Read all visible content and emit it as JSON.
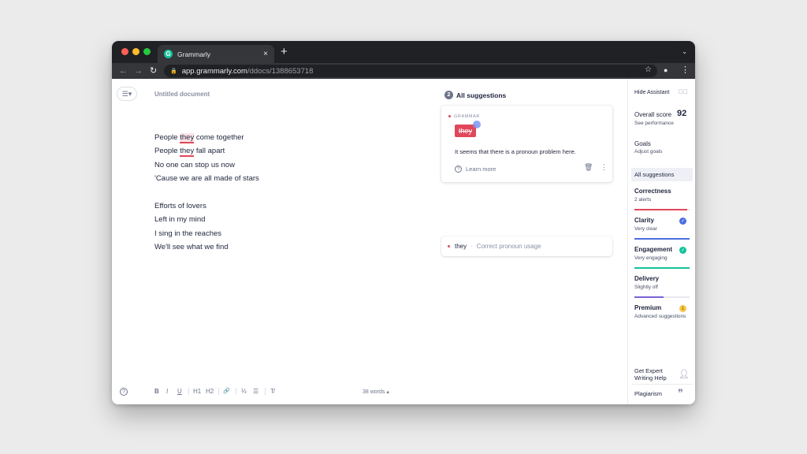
{
  "browser": {
    "tab_title": "Grammarly",
    "tab_close": "×",
    "new_tab": "+",
    "url_host": "app.grammarly.com",
    "url_path": "/ddocs/1388653718"
  },
  "editor": {
    "menu_glyph": "☰▾",
    "doc_title": "Untitled document",
    "lines": [
      {
        "pre": "People ",
        "err": "they",
        "post": " come together"
      },
      {
        "pre": "People ",
        "err": "they",
        "post": " fall apart"
      },
      {
        "text": "No one can stop us now"
      },
      {
        "text": "'Cause we are all made of stars"
      },
      {
        "text": "Efforts of lovers"
      },
      {
        "text": "Left in my mind"
      },
      {
        "text": "I sing in the reaches"
      },
      {
        "text": "We'll see what we find"
      }
    ],
    "word_count": "38 words ▴",
    "format": {
      "bold": "B",
      "italic": "I",
      "underline": "U",
      "h1": "H1",
      "h2": "H2",
      "link": "🔗",
      "ol": "⅓",
      "ul": "☰",
      "clear": "T̸"
    }
  },
  "suggestions": {
    "count": "2",
    "title": "All suggestions",
    "card": {
      "category": "GRAMMAR",
      "struck_word": "they",
      "message": "It seems that there is a pronoun problem here.",
      "learn_more": "Learn more"
    },
    "mini": {
      "word": "they",
      "separator": "·",
      "description": "Correct pronoun usage"
    }
  },
  "sidebar": {
    "hide_assistant": "Hide Assistant",
    "overall_score_label": "Overall score",
    "overall_score": "92",
    "see_performance": "See performance",
    "goals": "Goals",
    "adjust_goals": "Adjust goals",
    "all_suggestions": "All suggestions",
    "categories": [
      {
        "name": "Correctness",
        "sub": "2 alerts",
        "color": "#e1475a",
        "fill": 0.96
      },
      {
        "name": "Clarity",
        "sub": "Very clear",
        "color": "#4a6ee0",
        "fill": 1.0
      },
      {
        "name": "Engagement",
        "sub": "Very engaging",
        "color": "#15c39a",
        "fill": 1.0
      },
      {
        "name": "Delivery",
        "sub": "Slightly off",
        "color": "#7b61d6",
        "fill": 0.53
      }
    ],
    "premium": "Premium",
    "premium_count": "1",
    "premium_sub": "Advanced suggestions",
    "expert_line1": "Get Expert",
    "expert_line2": "Writing Help",
    "plagiarism": "Plagiarism"
  }
}
